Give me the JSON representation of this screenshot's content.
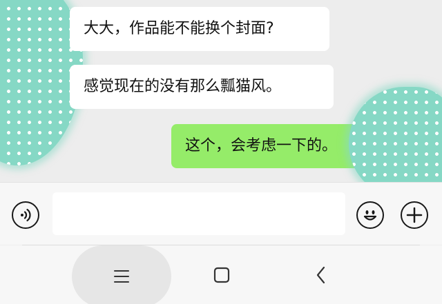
{
  "chat": {
    "messages": [
      {
        "side": "incoming",
        "text": "大大，作品能不能换个封面?"
      },
      {
        "side": "incoming",
        "text": "感觉现在的没有那么瓢猫风。"
      },
      {
        "side": "outgoing",
        "text": "这个，会考虑一下的。"
      }
    ]
  },
  "input_bar": {
    "voice_icon": "voice-icon",
    "message_value": "",
    "emoji_icon": "emoji-icon",
    "plus_icon": "plus-icon"
  },
  "nav_bar": {
    "menu_icon": "menu-icon",
    "home_icon": "home-icon",
    "back_icon": "back-icon"
  },
  "colors": {
    "background": "#ededed",
    "incoming_bubble": "#ffffff",
    "outgoing_bubble": "#95ec69",
    "blob": "#86d8c5"
  }
}
